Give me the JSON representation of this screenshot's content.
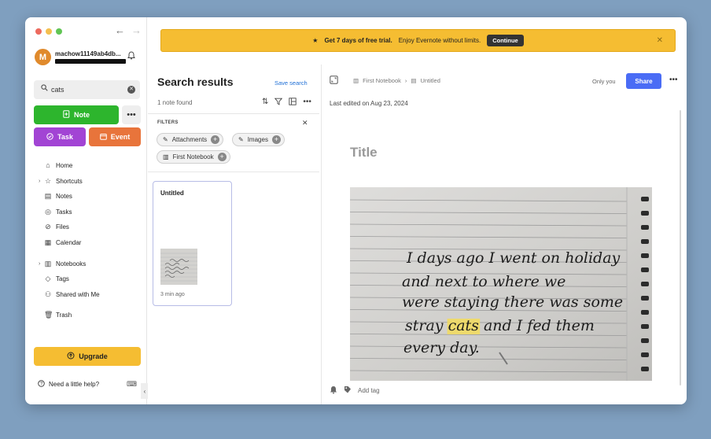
{
  "sidebar": {
    "user": {
      "initial": "M",
      "name": "machow11149ab4db..."
    },
    "search": {
      "value": "cats"
    },
    "buttons": {
      "note": "Note",
      "task": "Task",
      "event": "Event",
      "upgrade": "Upgrade"
    },
    "items": [
      {
        "label": "Home",
        "icon": "home-icon"
      },
      {
        "label": "Shortcuts",
        "icon": "star-icon"
      },
      {
        "label": "Notes",
        "icon": "note-icon"
      },
      {
        "label": "Tasks",
        "icon": "task-icon"
      },
      {
        "label": "Files",
        "icon": "paperclip-icon"
      },
      {
        "label": "Calendar",
        "icon": "calendar-icon"
      },
      {
        "label": "Notebooks",
        "icon": "notebook-icon"
      },
      {
        "label": "Tags",
        "icon": "tag-icon"
      },
      {
        "label": "Shared with Me",
        "icon": "people-icon"
      },
      {
        "label": "Trash",
        "icon": "trash-icon"
      }
    ],
    "help": "Need a little help?"
  },
  "banner": {
    "message": "Get 7 days of free trial.",
    "detail": "Enjoy Evernote without limits.",
    "button": "Continue"
  },
  "results": {
    "title": "Search results",
    "save_search": "Save search",
    "count": "1 note found",
    "filters_title": "FILTERS",
    "chips": [
      "Attachments",
      "Images",
      "First Notebook"
    ],
    "card": {
      "title": "Untitled",
      "time": "3 min ago"
    }
  },
  "note": {
    "breadcrumb": {
      "notebook": "First Notebook",
      "separator": "›",
      "note": "Untitled"
    },
    "visibility": "Only you",
    "share": "Share",
    "edited": "Last edited on Aug 23, 2024",
    "title_placeholder": "Title",
    "add_tag": "Add tag",
    "handwriting": [
      "I days ago I went on holiday",
      "and next to where we",
      "were staying there was some",
      "stray cats and I fed them",
      "every day."
    ],
    "highlight_word": "cats"
  },
  "colors": {
    "note_button": "#2db52d",
    "task_button": "#a244d4",
    "event_button": "#e8743b",
    "upgrade": "#f5bd32",
    "share": "#4a6cf5",
    "highlight": "#f3dc5c"
  }
}
